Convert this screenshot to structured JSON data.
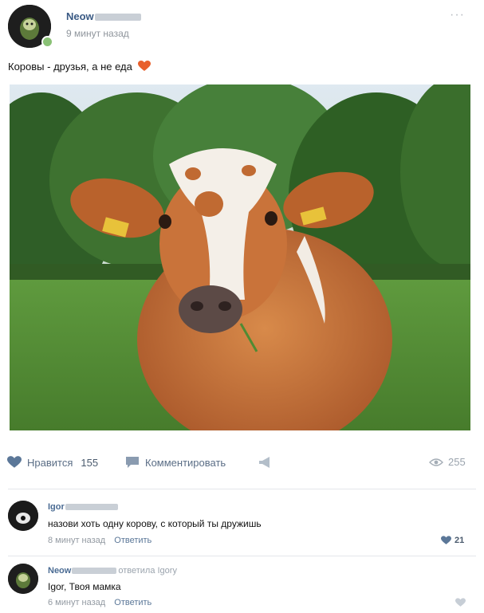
{
  "post": {
    "author_name": "Neow",
    "time": "9 минут назад",
    "text": "Коровы - друзья, а не еда",
    "more": "···"
  },
  "actions": {
    "like_label": "Нравится",
    "like_count": "155",
    "comment_label": "Комментировать",
    "views": "255"
  },
  "comments": [
    {
      "author": "Igor",
      "text": "назови хоть одну корову, с который ты дружишь",
      "time": "8 минут назад",
      "reply_label": "Ответить",
      "likes": "21"
    },
    {
      "author": "Neow",
      "reply_to": "ответила Igory",
      "text": "Igor, Твоя мамка",
      "time": "6 минут назад",
      "reply_label": "Ответить"
    }
  ],
  "colors": {
    "link": "#3a5a84",
    "accent_heart": "#e8602c",
    "like_blue": "#5b7798"
  }
}
